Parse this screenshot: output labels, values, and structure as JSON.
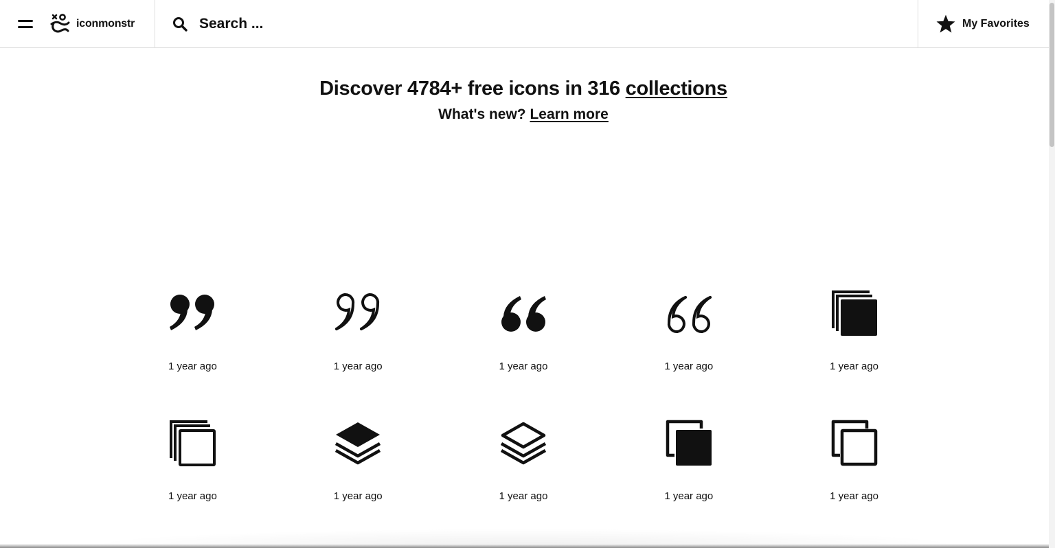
{
  "header": {
    "brand_name": "iconmonstr",
    "search_placeholder": "Search ...",
    "favorites_label": "My Favorites"
  },
  "hero": {
    "title_prefix": "Discover 4784+ free icons in 316 ",
    "title_link": "collections",
    "subtitle_prefix": "What's new? ",
    "subtitle_link": "Learn more"
  },
  "icons": [
    {
      "icon": "quote-right-filled-icon",
      "time": "1 year ago"
    },
    {
      "icon": "quote-right-outline-icon",
      "time": "1 year ago"
    },
    {
      "icon": "quote-left-filled-icon",
      "time": "1 year ago"
    },
    {
      "icon": "quote-left-outline-icon",
      "time": "1 year ago"
    },
    {
      "icon": "stacked-squares-filled-icon",
      "time": "1 year ago"
    },
    {
      "icon": "stacked-squares-outline-icon",
      "time": "1 year ago"
    },
    {
      "icon": "layers-filled-icon",
      "time": "1 year ago"
    },
    {
      "icon": "layers-outline-icon",
      "time": "1 year ago"
    },
    {
      "icon": "copy-filled-icon",
      "time": "1 year ago"
    },
    {
      "icon": "copy-outline-icon",
      "time": "1 year ago"
    }
  ]
}
